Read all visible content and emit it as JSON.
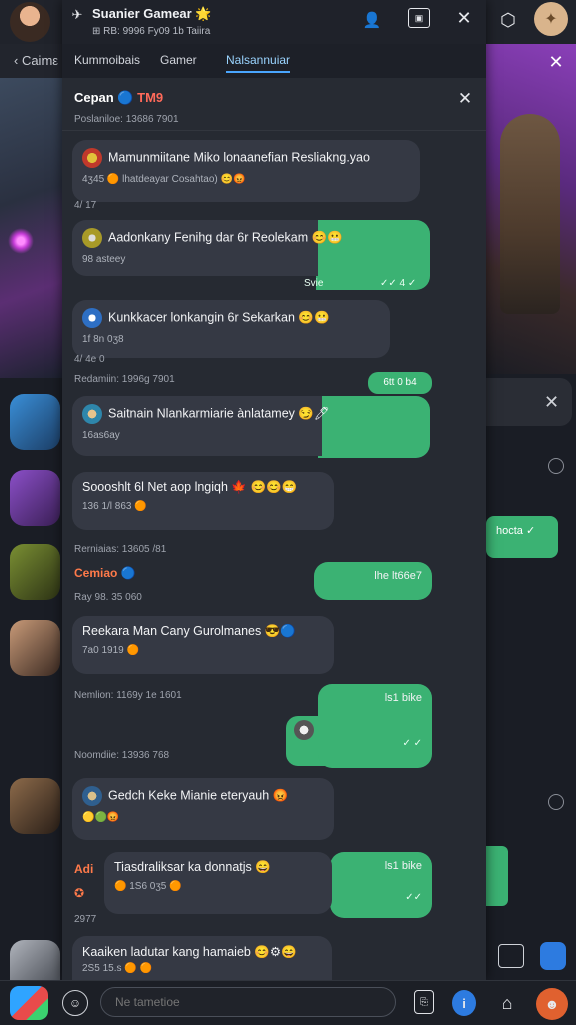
{
  "colors": {
    "accent_green": "#3bb273",
    "accent_blue": "#4aa6ff",
    "panel_bg": "#262a32",
    "bubble_bg": "#353944",
    "highlight_red": "#ff6a5a"
  },
  "background": {
    "left_header_label": "‹ Caimε",
    "right_green_label": "hocta",
    "contacts": [
      "contact-1",
      "contact-2",
      "contact-3",
      "contact-4",
      "contact-5",
      "contact-6",
      "contact-7"
    ]
  },
  "window": {
    "title": "Suanier Gamear 🌟",
    "subtitle": "⊞ RB: 9996 Fy09 1b Taiira",
    "icons": [
      "user-icon",
      "window-icon",
      "close-icon"
    ]
  },
  "tabs": [
    "Kummoibais",
    "Gamer",
    "Nalsannuiar"
  ],
  "chat": {
    "title": "Cepan",
    "title_badge": "🔵 TM9",
    "subtitle": "Poslaniloe: 13686 7901",
    "close_icon": "close-icon"
  },
  "messages": [
    {
      "text": "Mamunmiitane Miko lonaanefian Resliakng.yao",
      "meta": "4ʒ45 🟠 lhatdeayar Cosahtao) 😊😡",
      "time": "4/ 17",
      "avatar": "#c0392b"
    },
    {
      "text": "Aadonkany Fenihg dar 6r Reolekam 😊😬",
      "meta": "98 asteey",
      "time": "",
      "green_meta": "Svie",
      "green_check": "✓✓ 4 ✓",
      "avatar": "#b8a23a"
    },
    {
      "text": "Kunkkacer lonkangin 6r Sekarkan 😊😬",
      "meta": "1f 8n 0ʒ8",
      "time": "4/ 4e 0",
      "avatar": "#3a7bd5"
    },
    {
      "text": "Saitnain Nlankarmiarie ànlatamey 😏🖊",
      "meta": "16as6ay",
      "pill": "6tt 0 b4",
      "avatar": "#2e86ab"
    },
    {
      "text": "Soooshlt 6l Net aop lngiqh 🍁 😊😊😁",
      "meta": "136 1/l 863 🟠",
      "avatar": ""
    },
    {
      "text": "Reekara Man Cany Gurolmanes 😎🔵",
      "meta": "7a0 1919 🟠",
      "avatar": ""
    },
    {
      "text": "Gedch Keke Mianie eteryauh 😡",
      "meta": "🟡🟢😡",
      "avatar": "#2f5f8f"
    },
    {
      "text": "Tiasdraliksar ka donnatjs 😄",
      "meta": "🟠 1S6 0ʒ5 🟠",
      "side_name": "Adi",
      "side_time": "2977",
      "avatar": ""
    },
    {
      "text": "Kaaiken ladutar kang hamaieb 😊⚙😄",
      "meta": "2S5 15.s 🟠 🟠",
      "avatar": ""
    }
  ],
  "notes": [
    "Redamiin: 1996g 7901",
    "Rerniaias: 13605 /81",
    "Cemiao 🔵",
    "Ray 98. 35 060",
    "Nemlion: 1169y 1e 1601",
    "Noomdiie: 13936 768"
  ],
  "green_messages": [
    {
      "label": "lhe lt66e7"
    },
    {
      "label": "ls1 bike",
      "check": "✓ ✓"
    },
    {
      "label": "ls1 bike",
      "check": "✓✓"
    }
  ],
  "composer": {
    "placeholder": "Ne tametioe",
    "icons": [
      "emoji-icon",
      "attach-icon",
      "info-icon",
      "home-icon",
      "profile-icon"
    ]
  }
}
